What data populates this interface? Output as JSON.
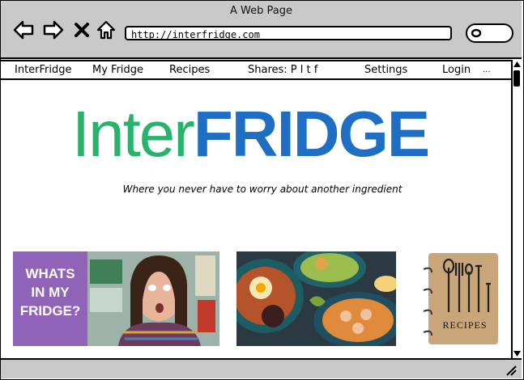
{
  "window": {
    "title": "A Web Page"
  },
  "browser": {
    "url": "http://interfridge.com",
    "icons": [
      "back-arrow-icon",
      "forward-arrow-icon",
      "close-x-icon",
      "home-icon",
      "search-icon"
    ]
  },
  "menu": {
    "items": [
      {
        "label": "InterFridge"
      },
      {
        "label": "My Fridge"
      },
      {
        "label": "Recipes"
      },
      {
        "label": "Shares: P l t f"
      },
      {
        "label": "Settings"
      },
      {
        "label": "Login"
      },
      {
        "label": "..."
      }
    ]
  },
  "hero": {
    "logo_part1": "Inter",
    "logo_part2": "FRIDGE",
    "tagline": "Where you never have to worry about another ingredient",
    "colors": {
      "logo_part1": "#27b36b",
      "logo_part2": "#1e6fc4"
    }
  },
  "tiles": [
    {
      "caption_lines": [
        "WHATS",
        "IN MY",
        "FRIDGE?"
      ]
    },
    {
      "caption_lines": []
    },
    {
      "caption_lines": [
        "RECIPES"
      ]
    }
  ],
  "colors": {
    "chrome": "#c9c9c9",
    "tile_purple": "#8f63b8"
  }
}
